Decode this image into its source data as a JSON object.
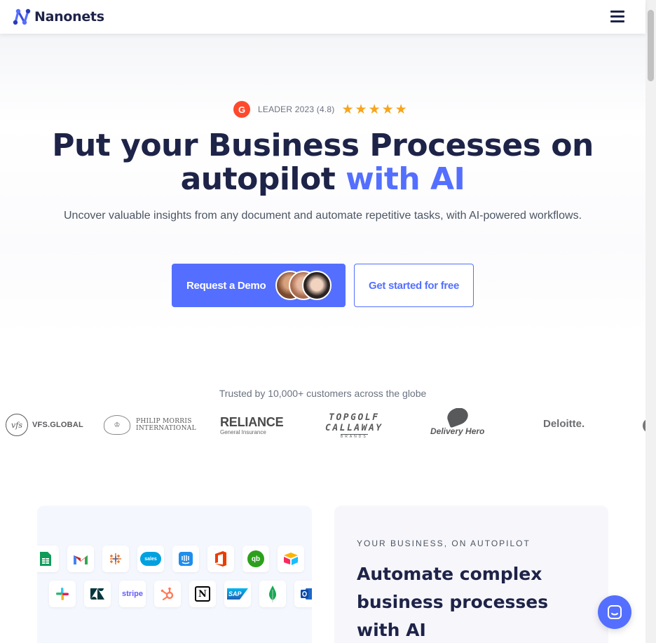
{
  "header": {
    "brand": "Nanonets"
  },
  "badge": {
    "g2": "G",
    "text": "LEADER 2023 (4.8)",
    "stars": [
      "★",
      "★",
      "★",
      "★",
      "★"
    ]
  },
  "hero": {
    "title_line1": "Put your Business Processes on",
    "title_line2": "autopilot ",
    "title_accent": "with AI",
    "subtitle": "Uncover valuable insights from any document and automate repetitive tasks, with AI-powered workflows.",
    "cta_demo": "Request a Demo",
    "cta_free": "Get started for free"
  },
  "trusted": {
    "text": "Trusted by 10,000+ customers across the globe",
    "logos": {
      "vfs_mark": "vfs",
      "vfs": "VFS.GLOBAL",
      "pmi_line1": "PHILIP MORRIS",
      "pmi_line2": "INTERNATIONAL",
      "reliance": "RELIANCE",
      "reliance_sub": "General Insurance",
      "topgolf": "TOPGOLF",
      "callaway": "CALLAWAY",
      "brands": "BRANDS",
      "delivery_hero": "Delivery Hero",
      "deloitte": "Deloitte."
    }
  },
  "integrations": {
    "row1": [
      "sheets-icon",
      "gmail-icon",
      "tableau-icon",
      "salesforce-icon",
      "intercom-icon",
      "office-icon",
      "quickbooks-icon",
      "airtable-icon"
    ],
    "row2": [
      "slack-icon",
      "zendesk-icon",
      "stripe-icon",
      "hubspot-icon",
      "notion-icon",
      "sap-icon",
      "mongodb-icon",
      "outlook-icon"
    ],
    "labels": {
      "stripe": "stripe",
      "sap": "SAP",
      "qb": "qb",
      "notion": "N",
      "salesforce": "sales"
    }
  },
  "feature": {
    "eyebrow": "YOUR BUSINESS, ON AUTOPILOT",
    "title": "Automate complex business processes with AI"
  },
  "colors": {
    "accent": "#546fff",
    "ink": "#1e2348",
    "star": "#f7a51d",
    "g2": "#ff492c"
  }
}
